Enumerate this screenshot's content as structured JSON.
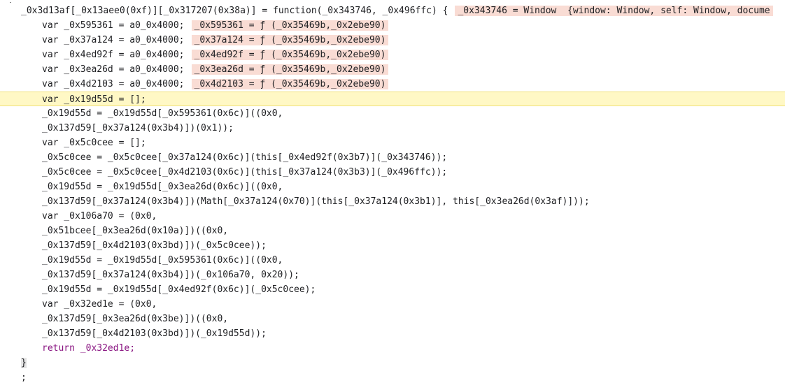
{
  "lines": [
    {
      "text": "_0x3d13af[_0x13aee0(0xf)][_0x317207(0x38a)] = function(_0x343746, _0x496ffc) {",
      "inline": "_0x343746 = Window  {window: Window, self: Window, docume"
    },
    {
      "text": "var _0x595361 = a0_0x4000;",
      "inline": "_0x595361 = ƒ (_0x35469b,_0x2ebe90)"
    },
    {
      "text": "var _0x37a124 = a0_0x4000;",
      "inline": "_0x37a124 = ƒ (_0x35469b,_0x2ebe90)"
    },
    {
      "text": "var _0x4ed92f = a0_0x4000;",
      "inline": "_0x4ed92f = ƒ (_0x35469b,_0x2ebe90)"
    },
    {
      "text": "var _0x3ea26d = a0_0x4000;",
      "inline": "_0x3ea26d = ƒ (_0x35469b,_0x2ebe90)"
    },
    {
      "text": "var _0x4d2103 = a0_0x4000;",
      "inline": "_0x4d2103 = ƒ (_0x35469b,_0x2ebe90)"
    },
    {
      "text": "var _0x19d55d = [];",
      "inline": ""
    },
    {
      "text": "_0x19d55d = _0x19d55d[_0x595361(0x6c)]((0x0,",
      "inline": ""
    },
    {
      "text": "_0x137d59[_0x37a124(0x3b4)])(0x1));",
      "inline": ""
    },
    {
      "text": "var _0x5c0cee = [];",
      "inline": ""
    },
    {
      "text": "_0x5c0cee = _0x5c0cee[_0x37a124(0x6c)](this[_0x4ed92f(0x3b7)](_0x343746));",
      "inline": ""
    },
    {
      "text": "_0x5c0cee = _0x5c0cee[_0x4d2103(0x6c)](this[_0x37a124(0x3b3)](_0x496ffc));",
      "inline": ""
    },
    {
      "text": "_0x19d55d = _0x19d55d[_0x3ea26d(0x6c)]((0x0,",
      "inline": ""
    },
    {
      "text": "_0x137d59[_0x37a124(0x3b4)])(Math[_0x37a124(0x70)](this[_0x37a124(0x3b1)], this[_0x3ea26d(0x3af)]));",
      "inline": ""
    },
    {
      "text": "var _0x106a70 = (0x0,",
      "inline": ""
    },
    {
      "text": "_0x51bcee[_0x3ea26d(0x10a)])((0x0,",
      "inline": ""
    },
    {
      "text": "_0x137d59[_0x4d2103(0x3bd)])(_0x5c0cee));",
      "inline": ""
    },
    {
      "text": "_0x19d55d = _0x19d55d[_0x595361(0x6c)]((0x0,",
      "inline": ""
    },
    {
      "text": "_0x137d59[_0x37a124(0x3b4)])(_0x106a70, 0x20));",
      "inline": ""
    },
    {
      "text": "_0x19d55d = _0x19d55d[_0x4ed92f(0x6c)](_0x5c0cee);",
      "inline": ""
    },
    {
      "text": "var _0x32ed1e = (0x0,",
      "inline": ""
    },
    {
      "text": "_0x137d59[_0x3ea26d(0x3be)])((0x0,",
      "inline": ""
    },
    {
      "text": "_0x137d59[_0x4d2103(0x3bd)])(_0x19d55d));",
      "inline": ""
    },
    {
      "text": "return _0x32ed1e;",
      "inline": ""
    },
    {
      "text": "}",
      "inline": ""
    },
    {
      "text": ";",
      "inline": ""
    }
  ]
}
